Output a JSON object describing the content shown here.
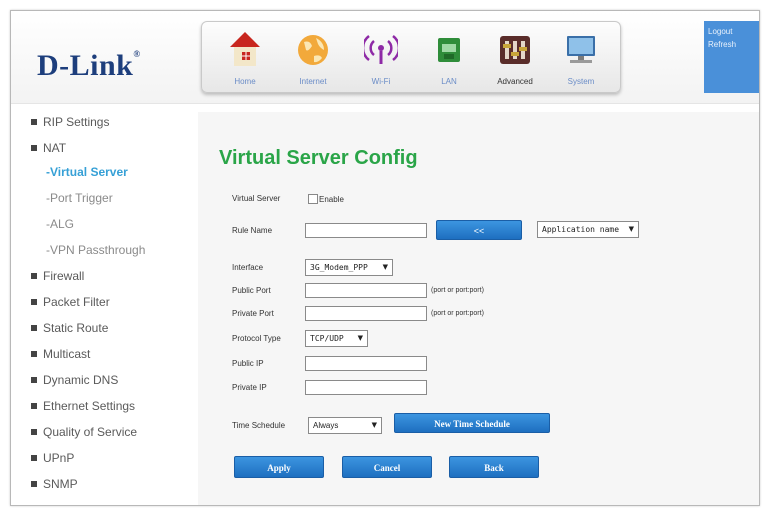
{
  "brand": {
    "logo": "D-Link",
    "registered": "®"
  },
  "nav": [
    {
      "label": "Home",
      "icon": "home-icon"
    },
    {
      "label": "Internet",
      "icon": "globe-icon"
    },
    {
      "label": "Wi-Fi",
      "icon": "wifi-icon"
    },
    {
      "label": "LAN",
      "icon": "lan-icon"
    },
    {
      "label": "Advanced",
      "icon": "advanced-icon"
    },
    {
      "label": "System",
      "icon": "system-icon"
    }
  ],
  "top_right": {
    "logout": "Logout",
    "refresh": "Refresh"
  },
  "sidebar": [
    {
      "label": "RIP Settings"
    },
    {
      "label": "NAT"
    },
    {
      "label": "-Virtual Server"
    },
    {
      "label": "-Port Trigger"
    },
    {
      "label": "-ALG"
    },
    {
      "label": "-VPN Passthrough"
    },
    {
      "label": "Firewall"
    },
    {
      "label": "Packet Filter"
    },
    {
      "label": "Static Route"
    },
    {
      "label": "Multicast"
    },
    {
      "label": "Dynamic DNS"
    },
    {
      "label": "Ethernet Settings"
    },
    {
      "label": "Quality of Service"
    },
    {
      "label": "UPnP"
    },
    {
      "label": "SNMP"
    }
  ],
  "form": {
    "title": "Virtual Server Config",
    "virtual_server_label": "Virtual Server",
    "enable_label": "Enable",
    "rule_name_label": "Rule Name",
    "copy_button": "<<",
    "application_select": "Application name",
    "interface_label": "Interface",
    "interface_value": "3G_Modem_PPP",
    "public_port_label": "Public Port",
    "public_port_hint": "(port or port:port)",
    "private_port_label": "Private Port",
    "private_port_hint": "(port or port:port)",
    "protocol_label": "Protocol Type",
    "protocol_value": "TCP/UDP",
    "public_ip_label": "Public IP",
    "private_ip_label": "Private IP",
    "schedule_label": "Time Schedule",
    "schedule_value": "Always",
    "new_schedule_button": "New Time Schedule",
    "apply_button": "Apply",
    "cancel_button": "Cancel",
    "back_button": "Back"
  }
}
